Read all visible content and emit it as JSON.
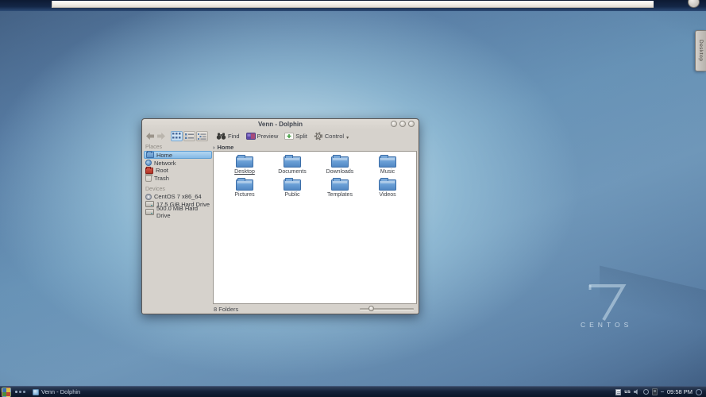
{
  "desktop": {
    "right_edge_tab": "Desktop",
    "watermark": {
      "number": "7",
      "brand": "CENTOS"
    }
  },
  "window": {
    "title": "Venn - Dolphin",
    "toolbar": {
      "find": "Find",
      "preview": "Preview",
      "split": "Split",
      "control": "Control"
    },
    "icons": {
      "breadcrumb_chevron": "›",
      "control_caret": "▾"
    },
    "breadcrumb": {
      "location": "Home"
    },
    "sidebar": {
      "places_header": "Places",
      "places": [
        "Home",
        "Network",
        "Root",
        "Trash"
      ],
      "devices_header": "Devices",
      "devices": [
        "CentOS 7 x86_64",
        "17.5 GiB Hard Drive",
        "500.0 MiB Hard Drive"
      ]
    },
    "folders": [
      "Desktop",
      "Documents",
      "Downloads",
      "Music",
      "Pictures",
      "Public",
      "Templates",
      "Videos"
    ],
    "status": {
      "summary": "8 Folders"
    }
  },
  "taskbar": {
    "task_label": "Venn - Dolphin",
    "keyboard_layout": "us",
    "clock": "09:58 PM"
  },
  "colors": {
    "selection_blue": "#85b9e6",
    "folder_blue": "#6ba0d6",
    "taskbar_bg": "#15223a",
    "window_bg": "#d6d2cc"
  }
}
